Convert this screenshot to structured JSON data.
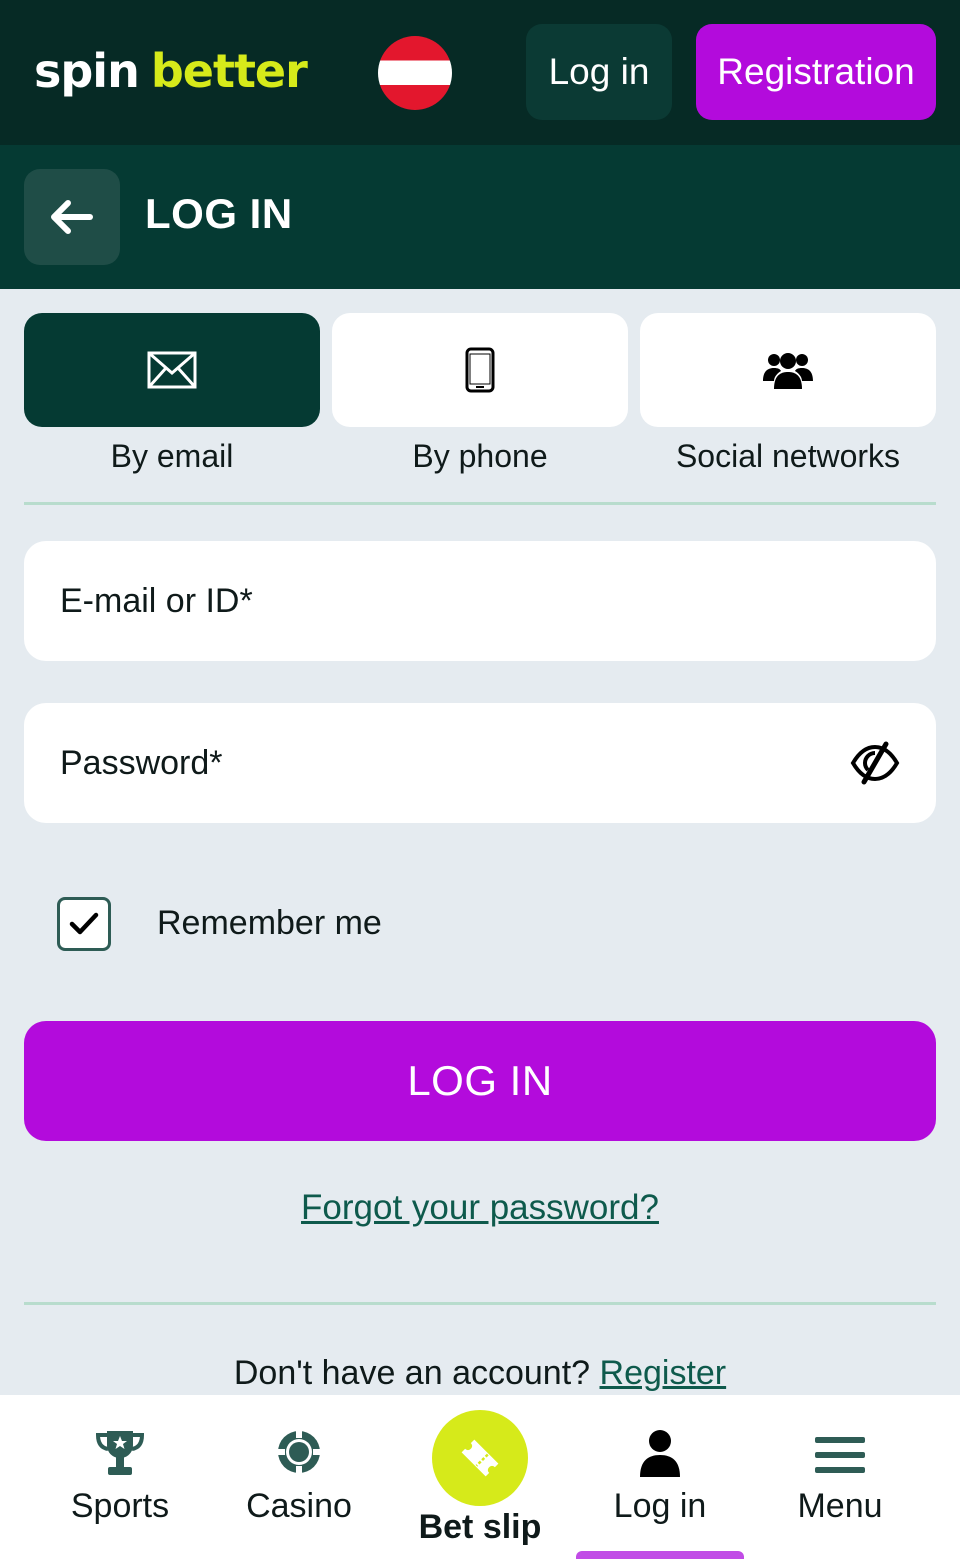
{
  "header": {
    "logo_part1": "spin",
    "logo_part2": "better",
    "login_label": "Log in",
    "register_label": "Registration"
  },
  "subheader": {
    "title": "LOG IN"
  },
  "tabs": [
    {
      "label": "By email",
      "icon": "envelope-icon",
      "active": true
    },
    {
      "label": "By phone",
      "icon": "phone-icon",
      "active": false
    },
    {
      "label": "Social networks",
      "icon": "users-icon",
      "active": false
    }
  ],
  "form": {
    "email_placeholder": "E-mail or ID*",
    "password_placeholder": "Password*",
    "remember_label": "Remember me",
    "remember_checked": true,
    "submit_label": "LOG IN",
    "forgot_label": "Forgot your password?",
    "no_account_text": "Don't have an account?",
    "register_link": "Register"
  },
  "bottom_nav": {
    "items": [
      {
        "label": "Sports",
        "icon": "trophy-icon"
      },
      {
        "label": "Casino",
        "icon": "casino-chip-icon"
      },
      {
        "label": "Bet slip",
        "icon": "ticket-icon"
      },
      {
        "label": "Log in",
        "icon": "user-icon",
        "active": true
      },
      {
        "label": "Menu",
        "icon": "hamburger-icon"
      }
    ]
  },
  "colors": {
    "header_bg": "#062a25",
    "subheader_bg": "#053a33",
    "accent_purple": "#b30bdc",
    "accent_lime": "#d6ea1a",
    "page_bg": "#e5ebf0",
    "link": "#0e5a4c"
  }
}
